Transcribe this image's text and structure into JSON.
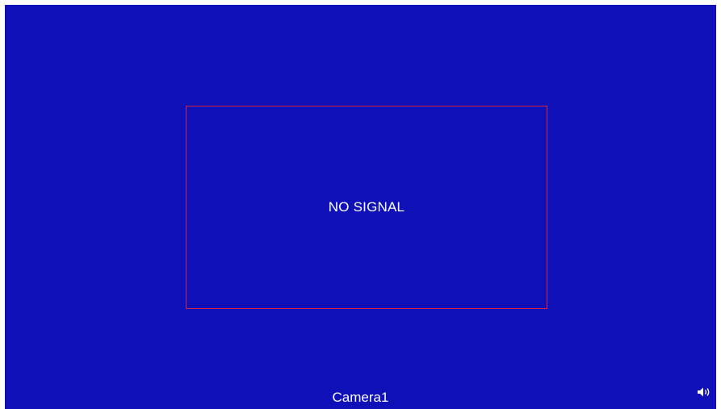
{
  "screen": {
    "background_color": "#0f10b8"
  },
  "signal_box": {
    "message": "NO SIGNAL",
    "border_color": "#d82440"
  },
  "footer": {
    "camera_label": "Camera1",
    "audio_icon": "speaker-icon"
  }
}
